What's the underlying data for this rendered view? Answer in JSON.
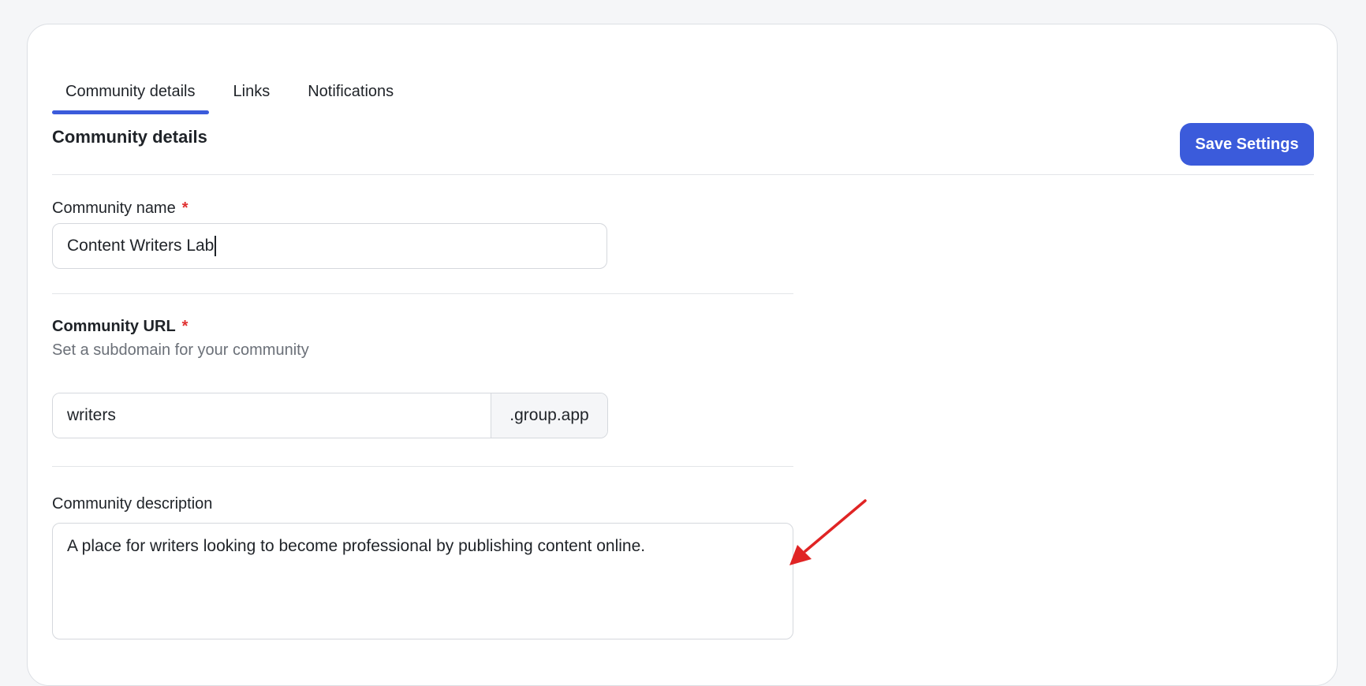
{
  "tabs": [
    {
      "label": "Community details",
      "active": true
    },
    {
      "label": "Links",
      "active": false
    },
    {
      "label": "Notifications",
      "active": false
    }
  ],
  "section": {
    "title": "Community details",
    "save_label": "Save Settings"
  },
  "fields": {
    "name": {
      "label": "Community name",
      "required_mark": "*",
      "value": "Content Writers Lab"
    },
    "url": {
      "label": "Community URL",
      "required_mark": "*",
      "help": "Set a subdomain for your community",
      "value": "writers",
      "suffix": ".group.app"
    },
    "description": {
      "label": "Community description",
      "value": "A place for writers looking to become professional by publishing content online."
    }
  },
  "colors": {
    "accent": "#3b5bdb",
    "required": "#e03131",
    "annotation_arrow": "#e02424"
  },
  "icons": {
    "annotation": "red-arrow-icon"
  }
}
